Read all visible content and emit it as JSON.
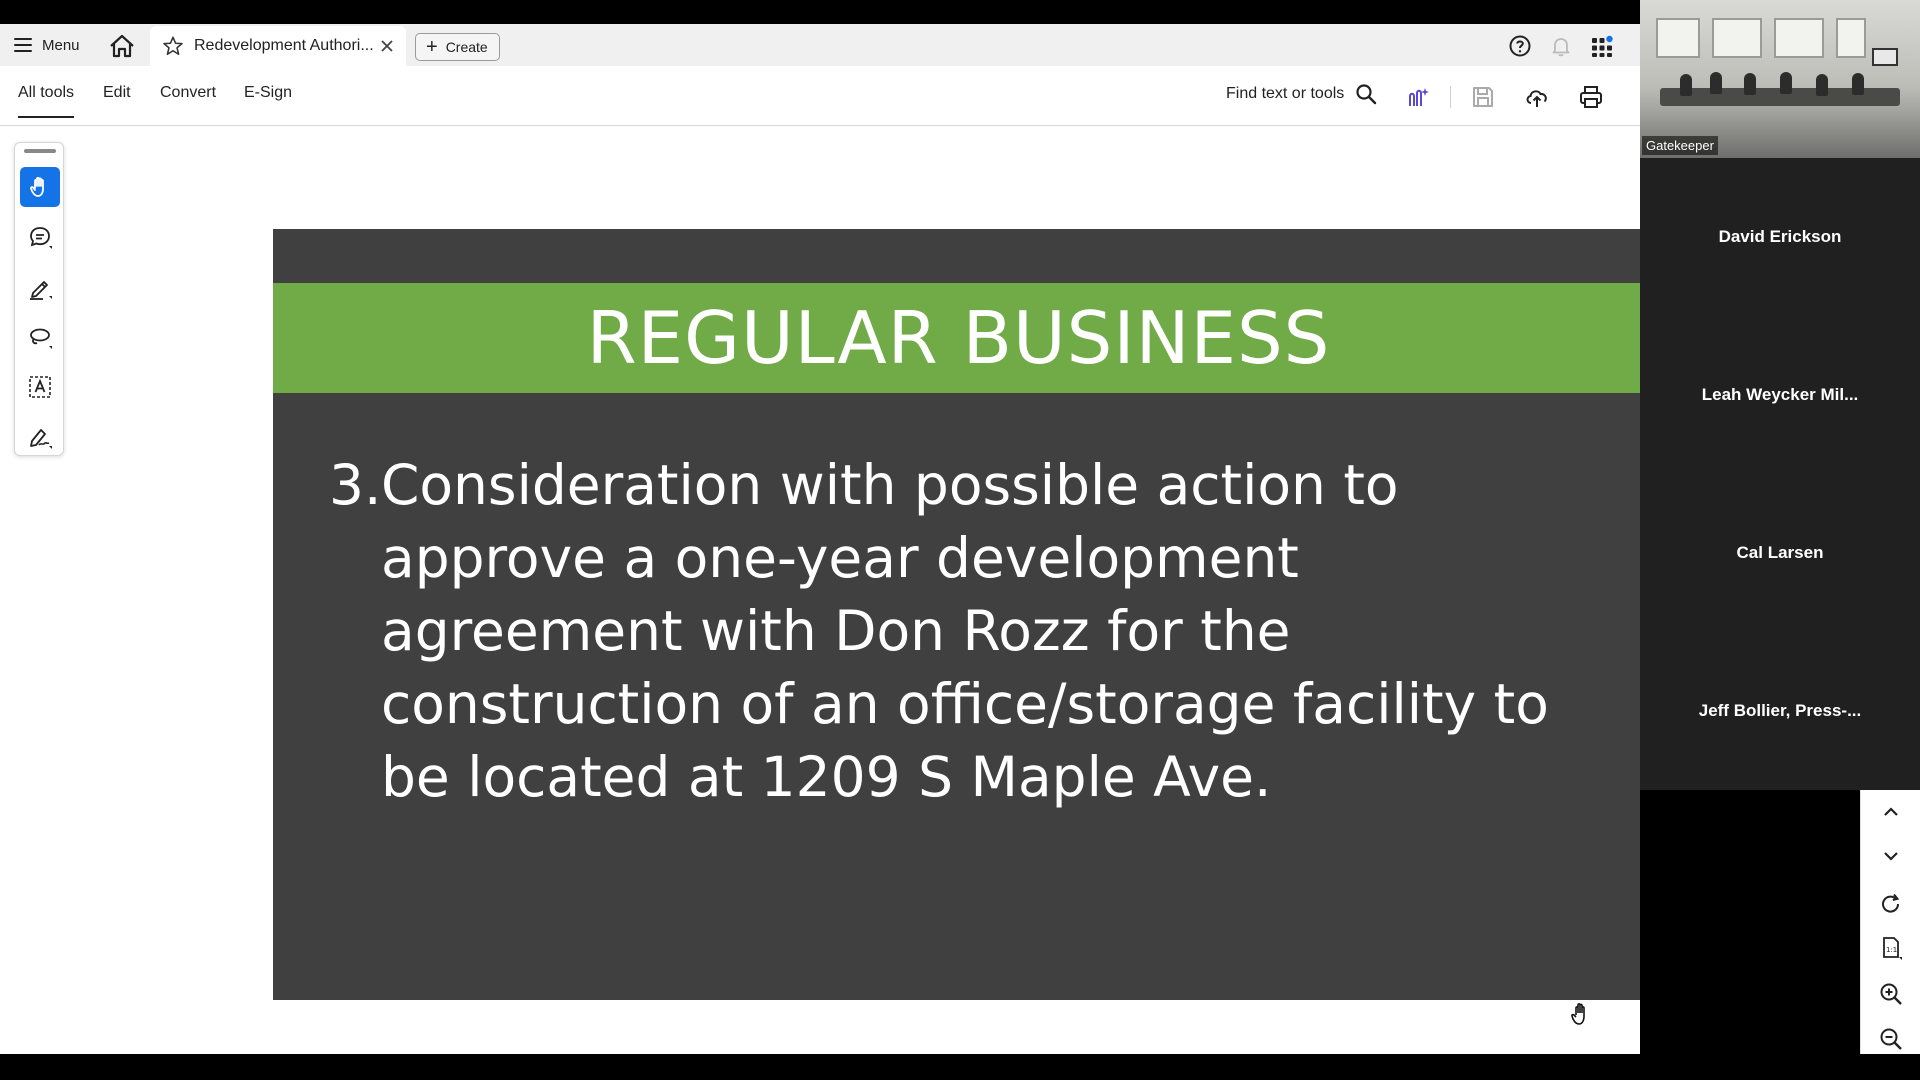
{
  "tabbar": {
    "menu_label": "Menu",
    "doc_tab_title": "Redevelopment Authori...",
    "create_label": "Create"
  },
  "toolbar": {
    "tabs": [
      {
        "label": "All tools"
      },
      {
        "label": "Edit"
      },
      {
        "label": "Convert"
      },
      {
        "label": "E-Sign"
      }
    ],
    "find_label": "Find text or tools"
  },
  "slide": {
    "title": "REGULAR BUSINESS",
    "item_number": "3.",
    "item_text": "Consideration with possible action to approve a one-year development agreement with Don Rozz for the construction of an office/storage facility to be located at 1209 S Maple Ave."
  },
  "video": {
    "camera_label": "Gatekeeper",
    "participants": [
      {
        "name": "David Erickson"
      },
      {
        "name": "Leah Weycker Mil..."
      },
      {
        "name": "Cal Larsen"
      },
      {
        "name": "Jeff Bollier, Press-..."
      }
    ]
  },
  "colors": {
    "accent": "#1473e6",
    "slide_background": "#404040",
    "slide_band": "#71ab48"
  }
}
